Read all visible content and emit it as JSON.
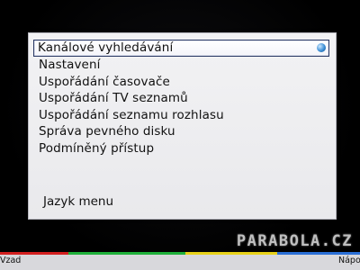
{
  "menu": {
    "items": [
      {
        "label": "Kanálové vyhledávání"
      },
      {
        "label": "Nastavení"
      },
      {
        "label": "Uspořádání časovače"
      },
      {
        "label": "Uspořádání TV seznamů"
      },
      {
        "label": "Uspořádání seznamu rozhlasu"
      },
      {
        "label": "Správa pevného disku"
      },
      {
        "label": "Podmíněný přístup"
      }
    ],
    "bottom_item": "Jazyk menu"
  },
  "bottom_bar": {
    "left_label": "Vzad",
    "right_label": "Nápo"
  },
  "watermark": "PARABOLA.CZ",
  "colors": {
    "red": "#d32020",
    "green": "#1fb03a",
    "yellow": "#e8d21a",
    "blue": "#2a6fd6",
    "selection_border": "#2b3a66"
  },
  "icons": {
    "selection_indicator": "blue-dot-icon"
  }
}
